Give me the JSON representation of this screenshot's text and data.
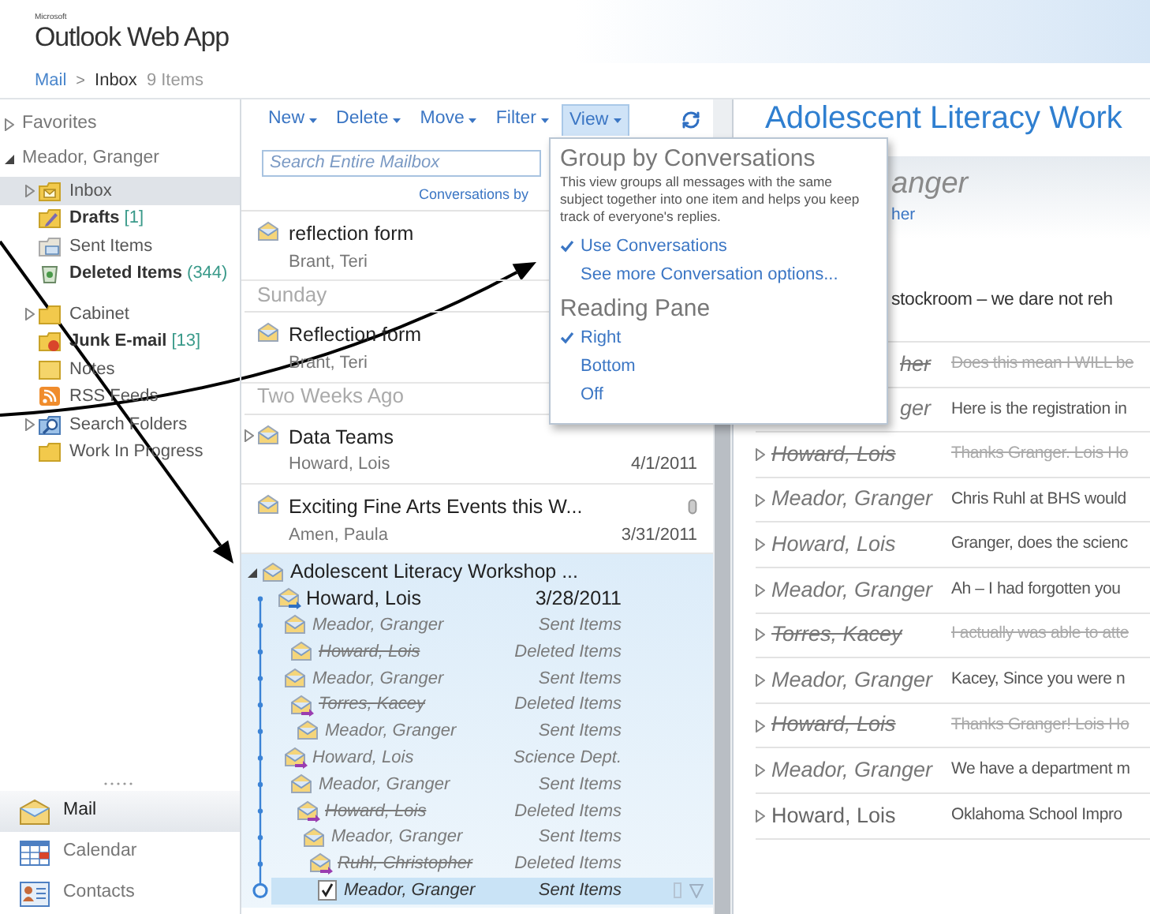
{
  "header": {
    "brand_small": "Microsoft",
    "brand": "Outlook Web App"
  },
  "breadcrumb": {
    "root": "Mail",
    "separator": ">",
    "folder": "Inbox",
    "count": "9 Items"
  },
  "sidebar": {
    "tree": [
      {
        "label": "Favorites",
        "expanded": false
      },
      {
        "label": "Meador, Granger",
        "expanded": true,
        "children": [
          {
            "label": "Inbox",
            "kind": "inbox",
            "expanded": false,
            "selected": true,
            "unread": false
          },
          {
            "label": "Drafts",
            "count": "[1]",
            "kind": "drafts",
            "selected": false,
            "unread": true
          },
          {
            "label": "Sent Items",
            "kind": "sent",
            "selected": false,
            "unread": false
          },
          {
            "label": "Deleted Items",
            "count": "(344)",
            "kind": "deleted",
            "selected": false,
            "unread": true
          },
          {
            "label": "Cabinet",
            "kind": "folder",
            "expanded": false,
            "separated": true,
            "selected": false,
            "unread": false
          },
          {
            "label": "Junk E-mail",
            "count": "[13]",
            "kind": "junk",
            "selected": false,
            "unread": true
          },
          {
            "label": "Notes",
            "kind": "notes",
            "selected": false,
            "unread": false
          },
          {
            "label": "RSS Feeds",
            "kind": "rss",
            "selected": false,
            "unread": false
          },
          {
            "label": "Search Folders",
            "kind": "search",
            "expanded": false,
            "selected": false,
            "unread": false
          },
          {
            "label": "Work In Progress",
            "kind": "folder",
            "selected": false,
            "unread": false
          }
        ]
      }
    ],
    "nav": [
      {
        "label": "Mail",
        "kind": "mail",
        "selected": true
      },
      {
        "label": "Calendar",
        "kind": "calendar",
        "selected": false
      },
      {
        "label": "Contacts",
        "kind": "contacts",
        "selected": false
      }
    ]
  },
  "toolbar": {
    "buttons": [
      {
        "label": "New",
        "selected": false
      },
      {
        "label": "Delete",
        "selected": false
      },
      {
        "label": "Move",
        "selected": false
      },
      {
        "label": "Filter",
        "selected": false
      },
      {
        "label": "View",
        "selected": true
      }
    ]
  },
  "search": {
    "placeholder": "Search Entire Mailbox"
  },
  "conversations_link": "Conversations by",
  "message_groups": [
    {
      "items": [
        {
          "kind": "message",
          "subject": "reflection form",
          "sender": "Brant, Teri",
          "selected": false
        }
      ]
    },
    {
      "heading": "Sunday",
      "items": [
        {
          "kind": "message",
          "subject": "Reflection form",
          "sender": "Brant, Teri",
          "selected": false
        }
      ]
    },
    {
      "heading": "Two Weeks Ago",
      "items": [
        {
          "kind": "conversation",
          "subject": "Data Teams",
          "sender": "Howard, Lois",
          "date": "4/1/2011",
          "expanded": false,
          "selected": false
        },
        {
          "kind": "message",
          "subject": "Exciting Fine Arts Events this W...",
          "sender": "Amen, Paula",
          "date": "3/31/2011",
          "attachment": true,
          "selected": false
        },
        {
          "kind": "conversation",
          "subject": "Adolescent Literacy Workshop ...",
          "expanded": true,
          "selected": true,
          "thread": [
            {
              "name": "Howard, Lois",
              "date": "3/28/2011",
              "kind": "forwarded",
              "read": false,
              "deleted": false,
              "selected": false,
              "children": [
                {
                  "name": "Meador, Granger",
                  "folder": "Sent Items",
                  "kind": "envelope",
                  "read": true,
                  "deleted": false,
                  "selected": false,
                  "children": [
                    {
                      "name": "Howard, Lois",
                      "folder": "Deleted Items",
                      "kind": "envelope",
                      "read": true,
                      "deleted": true,
                      "selected": false
                    }
                  ]
                },
                {
                  "name": "Meador, Granger",
                  "folder": "Sent Items",
                  "kind": "envelope",
                  "read": true,
                  "deleted": false,
                  "selected": false,
                  "children": [
                    {
                      "name": "Torres, Kacey",
                      "folder": "Deleted Items",
                      "kind": "replied",
                      "read": true,
                      "deleted": true,
                      "selected": false,
                      "children": [
                        {
                          "name": "Meador, Granger",
                          "folder": "Sent Items",
                          "kind": "envelope",
                          "read": true,
                          "deleted": false,
                          "selected": false
                        }
                      ]
                    }
                  ]
                },
                {
                  "name": "Howard, Lois",
                  "folder": "Science Dept.",
                  "kind": "replied",
                  "read": true,
                  "deleted": false,
                  "selected": false,
                  "children": [
                    {
                      "name": "Meador, Granger",
                      "folder": "Sent Items",
                      "kind": "envelope",
                      "read": true,
                      "deleted": false,
                      "selected": false,
                      "children": [
                        {
                          "name": "Howard, Lois",
                          "folder": "Deleted Items",
                          "kind": "replied",
                          "read": true,
                          "deleted": true,
                          "selected": false,
                          "children": [
                            {
                              "name": "Meador, Granger",
                              "folder": "Sent Items",
                              "kind": "envelope",
                              "read": true,
                              "deleted": false,
                              "selected": false,
                              "children": [
                                {
                                  "name": "Ruhl, Christopher",
                                  "folder": "Deleted Items",
                                  "kind": "replied",
                                  "read": true,
                                  "deleted": true,
                                  "selected": false,
                                  "children": [
                                    {
                                      "name": "Meador, Granger",
                                      "folder": "Sent Items",
                                      "kind": "checked-note",
                                      "read": true,
                                      "deleted": false,
                                      "selected": true
                                    }
                                  ]
                                }
                              ]
                            }
                          ]
                        }
                      ]
                    }
                  ]
                }
              ]
            }
          ]
        }
      ]
    }
  ],
  "view_menu": {
    "sections": [
      {
        "title": "Group by Conversations",
        "description": "This view groups all messages with the same subject together into one item and helps you keep track of everyone's replies.",
        "options": [
          {
            "label": "Use Conversations",
            "checked": true
          },
          {
            "label": "See more Conversation options...",
            "checked": false
          }
        ]
      },
      {
        "title": "Reading Pane",
        "options": [
          {
            "label": "Right",
            "checked": true
          },
          {
            "label": "Bottom",
            "checked": false
          },
          {
            "label": "Off",
            "checked": false
          }
        ]
      }
    ]
  },
  "reading_pane": {
    "title": "Adolescent Literacy Work",
    "sender": "anger",
    "recipient": "her",
    "body": "stockroom – we dare not reh",
    "thread": [
      {
        "name": "her",
        "preview": "Does this mean I WILL be",
        "deleted": true,
        "read": true
      },
      {
        "name": "ger",
        "preview": "Here is the registration in",
        "deleted": false,
        "read": true
      },
      {
        "name": "Howard, Lois",
        "preview": "Thanks Granger. Lois Ho",
        "deleted": true,
        "read": true,
        "expanded": false
      },
      {
        "name": "Meador, Granger",
        "preview": "Chris Ruhl at BHS would",
        "deleted": false,
        "read": true,
        "expanded": false
      },
      {
        "name": "Howard, Lois",
        "preview": "Granger, does the scienc",
        "deleted": false,
        "read": true,
        "expanded": false
      },
      {
        "name": "Meador, Granger",
        "preview": "Ah – I had forgotten you",
        "deleted": false,
        "read": true,
        "expanded": false
      },
      {
        "name": "Torres, Kacey",
        "preview": "I actually was able to atte",
        "deleted": true,
        "read": true,
        "expanded": false
      },
      {
        "name": "Meador, Granger",
        "preview": "Kacey, Since you were n",
        "deleted": false,
        "read": true,
        "expanded": false
      },
      {
        "name": "Howard, Lois",
        "preview": "Thanks Granger! Lois Ho",
        "deleted": true,
        "read": true,
        "expanded": false
      },
      {
        "name": "Meador, Granger",
        "preview": "We have a department m",
        "deleted": false,
        "read": true,
        "expanded": false
      },
      {
        "name": "Howard, Lois",
        "preview": "Oklahoma School Impro",
        "deleted": false,
        "read": false,
        "expanded": false
      }
    ]
  }
}
